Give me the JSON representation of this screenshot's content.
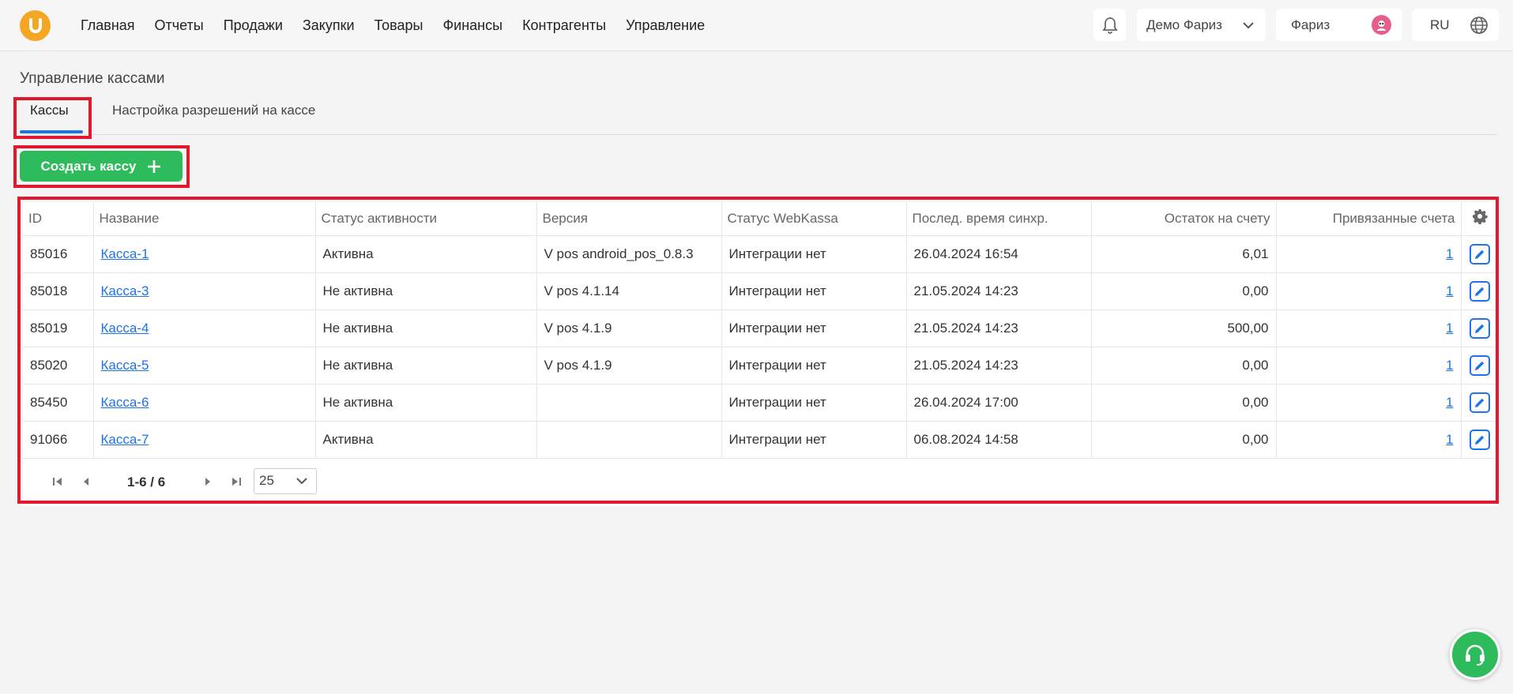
{
  "nav": {
    "items": [
      "Главная",
      "Отчеты",
      "Продажи",
      "Закупки",
      "Товары",
      "Финансы",
      "Контрагенты",
      "Управление"
    ],
    "company": "Демо Фариз",
    "user": "Фариз",
    "lang": "RU"
  },
  "page": {
    "title": "Управление кассами",
    "tabs": [
      "Кассы",
      "Настройка разрешений на кассе"
    ],
    "create_button": "Создать кассу"
  },
  "table": {
    "headers": {
      "id": "ID",
      "name": "Название",
      "active": "Статус активности",
      "version": "Версия",
      "webkassa": "Статус WebKassa",
      "sync": "Послед. время синхр.",
      "balance": "Остаток на счету",
      "accounts": "Привязанные счета"
    },
    "rows": [
      {
        "id": "85016",
        "name": "Касса-1",
        "active": "Активна",
        "version": "V pos android_pos_0.8.3",
        "webkassa": "Интеграции нет",
        "sync": "26.04.2024 16:54",
        "balance": "6,01",
        "accounts": "1"
      },
      {
        "id": "85018",
        "name": "Касса-3",
        "active": "Не активна",
        "version": "V pos 4.1.14",
        "webkassa": "Интеграции нет",
        "sync": "21.05.2024 14:23",
        "balance": "0,00",
        "accounts": "1"
      },
      {
        "id": "85019",
        "name": "Касса-4",
        "active": "Не активна",
        "version": "V pos 4.1.9",
        "webkassa": "Интеграции нет",
        "sync": "21.05.2024 14:23",
        "balance": "500,00",
        "accounts": "1"
      },
      {
        "id": "85020",
        "name": "Касса-5",
        "active": "Не активна",
        "version": "V pos 4.1.9",
        "webkassa": "Интеграции нет",
        "sync": "21.05.2024 14:23",
        "balance": "0,00",
        "accounts": "1"
      },
      {
        "id": "85450",
        "name": "Касса-6",
        "active": "Не активна",
        "version": "",
        "webkassa": "Интеграции нет",
        "sync": "26.04.2024 17:00",
        "balance": "0,00",
        "accounts": "1"
      },
      {
        "id": "91066",
        "name": "Касса-7",
        "active": "Активна",
        "version": "",
        "webkassa": "Интеграции нет",
        "sync": "06.08.2024 14:58",
        "balance": "0,00",
        "accounts": "1"
      }
    ]
  },
  "pager": {
    "info": "1-6 / 6",
    "page_size": "25"
  },
  "colors": {
    "accent": "#1e73e8",
    "primary_button": "#2ebb5b",
    "highlight": "#e0192c",
    "logo": "#f5a623"
  }
}
